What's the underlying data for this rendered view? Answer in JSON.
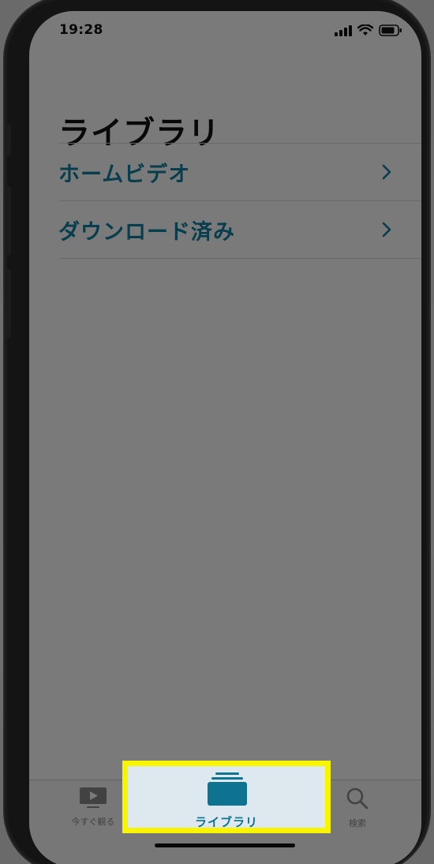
{
  "status_bar": {
    "time": "19:28",
    "icons": [
      "cellular-signal-icon",
      "wifi-icon",
      "battery-icon"
    ]
  },
  "page": {
    "title": "ライブラリ"
  },
  "list": {
    "items": [
      {
        "label": "ホームビデオ",
        "icon": "chevron-right-icon"
      },
      {
        "label": "ダウンロード済み",
        "icon": "chevron-right-icon"
      }
    ]
  },
  "tab_bar": {
    "tabs": [
      {
        "label": "今すぐ観る",
        "icon": "play-tv-icon",
        "selected": false
      },
      {
        "label": "ライブラリ",
        "icon": "library-stack-icon",
        "selected": true
      },
      {
        "label": "検索",
        "icon": "search-icon",
        "selected": false
      }
    ]
  },
  "colors": {
    "accent": "#0f7fa0",
    "highlight_border": "#f9f500",
    "dim_overlay": "#000000"
  }
}
